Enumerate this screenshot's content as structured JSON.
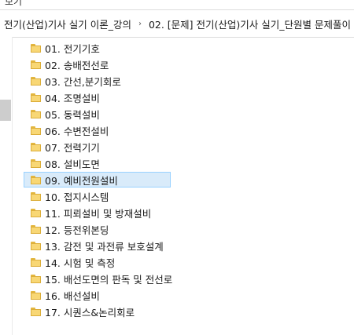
{
  "top_label": "보기",
  "breadcrumb": [
    "전기(산업)기사 실기 이론_강의",
    "02. [문제] 전기(산업)기사 실기_단원별 문제풀이"
  ],
  "breadcrumb_separator": "›",
  "folders": [
    {
      "name": "01. 전기기호",
      "selected": false
    },
    {
      "name": "02. 송배전선로",
      "selected": false
    },
    {
      "name": "03. 간선,분기회로",
      "selected": false
    },
    {
      "name": "04. 조명설비",
      "selected": false
    },
    {
      "name": "05. 동력설비",
      "selected": false
    },
    {
      "name": "06. 수변전설비",
      "selected": false
    },
    {
      "name": "07. 전력기기",
      "selected": false
    },
    {
      "name": "08. 설비도면",
      "selected": false
    },
    {
      "name": "09. 예비전원설비",
      "selected": true
    },
    {
      "name": "10. 접지시스템",
      "selected": false
    },
    {
      "name": "11. 피뢰설비 및 방재설비",
      "selected": false
    },
    {
      "name": "12. 등전위본딩",
      "selected": false
    },
    {
      "name": "13. 감전 및 과전류 보호설계",
      "selected": false
    },
    {
      "name": "14. 시험 및 측정",
      "selected": false
    },
    {
      "name": "15. 배선도면의 판독 및 전선로",
      "selected": false
    },
    {
      "name": "16. 배선설비",
      "selected": false
    },
    {
      "name": "17. 시퀀스&논리회로",
      "selected": false
    }
  ],
  "colors": {
    "folder": "#f8d775",
    "selection_bg": "#d9ebfa",
    "selection_border": "#99d1ff"
  },
  "icons": {
    "folder": "folder-icon",
    "separator": "chevron-right-icon"
  }
}
